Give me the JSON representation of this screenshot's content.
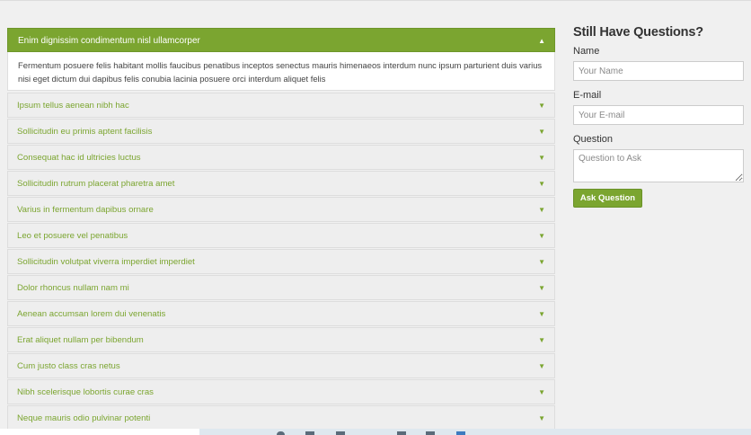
{
  "accordion": {
    "open": {
      "title": "Enim dignissim condimentum nisl ullamcorper",
      "body": "Fermentum posuere felis habitant mollis faucibus penatibus inceptos senectus mauris himenaeos interdum nunc ipsum parturient duis varius nisi eget dictum dui dapibus felis conubia lacinia posuere orci interdum aliquet felis",
      "chevron": "▲"
    },
    "items": [
      {
        "title": "Ipsum tellus aenean nibh hac",
        "chevron": "▼"
      },
      {
        "title": "Sollicitudin eu primis aptent facilisis",
        "chevron": "▼"
      },
      {
        "title": "Consequat hac id ultricies luctus",
        "chevron": "▼"
      },
      {
        "title": "Sollicitudin rutrum placerat pharetra amet",
        "chevron": "▼"
      },
      {
        "title": "Varius in fermentum dapibus ornare",
        "chevron": "▼"
      },
      {
        "title": "Leo et posuere vel penatibus",
        "chevron": "▼"
      },
      {
        "title": "Sollicitudin volutpat viverra imperdiet imperdiet",
        "chevron": "▼"
      },
      {
        "title": "Dolor rhoncus nullam nam mi",
        "chevron": "▼"
      },
      {
        "title": "Aenean accumsan lorem dui venenatis",
        "chevron": "▼"
      },
      {
        "title": "Erat aliquet nullam per bibendum",
        "chevron": "▼"
      },
      {
        "title": "Cum justo class cras netus",
        "chevron": "▼"
      },
      {
        "title": "Nibh scelerisque lobortis curae cras",
        "chevron": "▼"
      },
      {
        "title": "Neque mauris odio pulvinar potenti",
        "chevron": "▼"
      }
    ]
  },
  "sidebar": {
    "heading": "Still Have Questions?",
    "name_label": "Name",
    "name_placeholder": "Your Name",
    "email_label": "E-mail",
    "email_placeholder": "Your E-mail",
    "question_label": "Question",
    "question_placeholder": "Question to Ask",
    "submit_label": "Ask Question"
  },
  "colors": {
    "accent": "#7ba530",
    "background": "#f0f0f0"
  }
}
